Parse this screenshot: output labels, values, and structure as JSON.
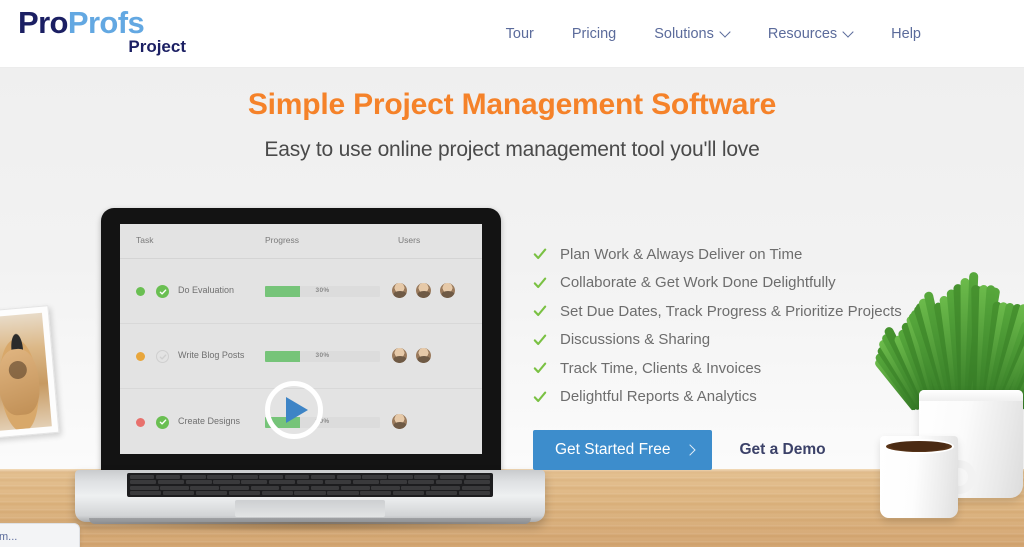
{
  "header": {
    "logo": {
      "part1": "Pro",
      "part2": "Profs",
      "sub": "Project"
    },
    "nav": [
      {
        "label": "Tour",
        "has_dropdown": false
      },
      {
        "label": "Pricing",
        "has_dropdown": false
      },
      {
        "label": "Solutions",
        "has_dropdown": true
      },
      {
        "label": "Resources",
        "has_dropdown": true
      },
      {
        "label": "Help",
        "has_dropdown": false
      }
    ]
  },
  "hero": {
    "headline": "Simple Project Management Software",
    "subhead": "Easy to use online project management tool you'll love",
    "features": [
      "Plan Work & Always Deliver on Time",
      "Collaborate & Get Work Done Delightfully",
      "Set Due Dates, Track Progress & Prioritize Projects",
      "Discussions & Sharing",
      "Track Time, Clients & Invoices",
      "Delightful Reports & Analytics"
    ],
    "cta": {
      "primary_label": "Get Started Free",
      "primary_arrow": "chevron-right-icon",
      "secondary_label": "Get a Demo"
    }
  },
  "laptop_screen": {
    "columns": [
      "Task",
      "Progress",
      "Users"
    ],
    "rows": [
      {
        "status_color": "#6abf52",
        "check_state": "complete",
        "task": "Do Evaluation",
        "progress_pct": 30,
        "progress_label": "30%",
        "users": 3
      },
      {
        "status_color": "#e8a63c",
        "check_state": "pending",
        "task": "Write Blog Posts",
        "progress_pct": 30,
        "progress_label": "30%",
        "users": 2
      },
      {
        "status_color": "#e8716d",
        "check_state": "complete",
        "task": "Create Designs",
        "progress_pct": 30,
        "progress_label": "30%",
        "users": 1
      }
    ],
    "video_overlay": "play-button-icon"
  },
  "widget": {
    "label": "m..."
  },
  "colors": {
    "brand_orange": "#f58229",
    "brand_blue": "#3d8dcc",
    "logo_navy": "#1b1f63",
    "logo_light_blue": "#63a8e2",
    "nav_text": "#5b6b9b",
    "check_green": "#7ac143",
    "progress_green": "#76c479",
    "desk_wood": "#ddb47f"
  }
}
